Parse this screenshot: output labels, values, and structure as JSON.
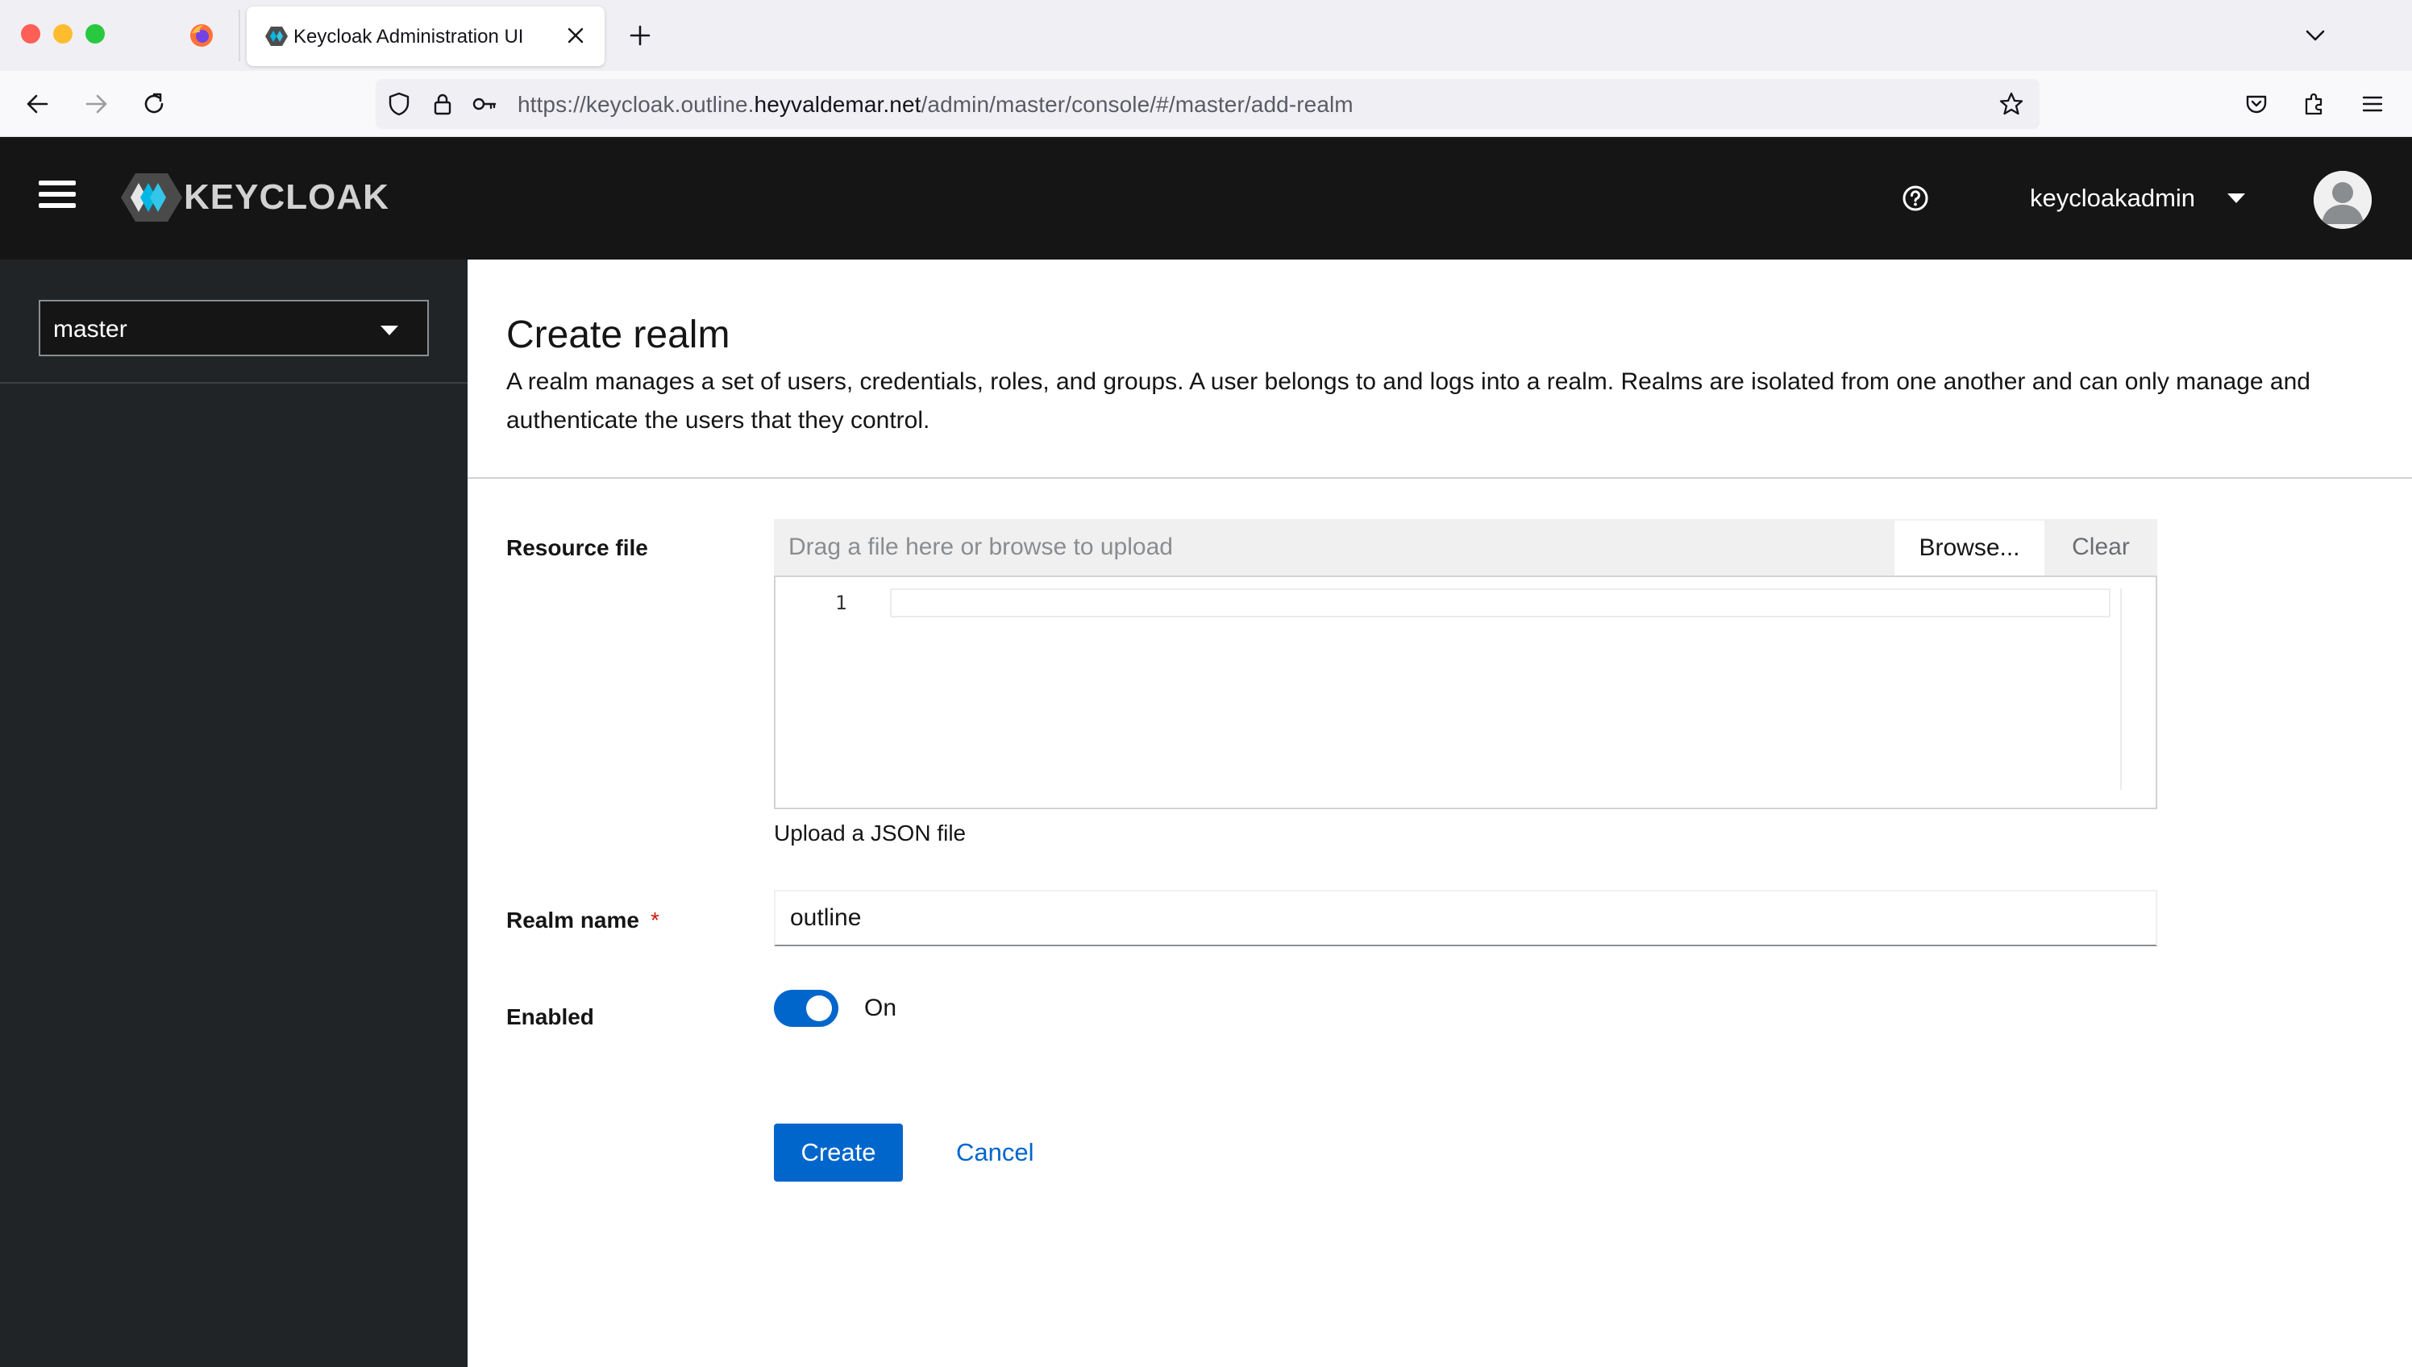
{
  "browser": {
    "tab_title": "Keycloak Administration UI",
    "url_prefix": "https://keycloak.outline.",
    "url_host": "heyvaldemar.net",
    "url_path": "/admin/master/console/#/master/add-realm"
  },
  "masthead": {
    "brand": "KEYCLOAK",
    "username": "keycloakadmin"
  },
  "sidebar": {
    "realm_selected": "master"
  },
  "page": {
    "title": "Create realm",
    "description": "A realm manages a set of users, credentials, roles, and groups. A user belongs to and logs into a realm. Realms are isolated from one another and can only manage and authenticate the users that they control."
  },
  "form": {
    "resource_file_label": "Resource file",
    "file_placeholder": "Drag a file here or browse to upload",
    "browse_label": "Browse...",
    "clear_label": "Clear",
    "editor_line_number": "1",
    "helper_text": "Upload a JSON file",
    "realm_name_label": "Realm name",
    "required_marker": "*",
    "realm_name_value": "outline",
    "enabled_label": "Enabled",
    "enabled_state": "On",
    "enabled": true,
    "create_label": "Create",
    "cancel_label": "Cancel"
  },
  "colors": {
    "primary": "#0066cc",
    "masthead_bg": "#151515",
    "sidebar_bg": "#212427",
    "required": "#c9190b"
  }
}
